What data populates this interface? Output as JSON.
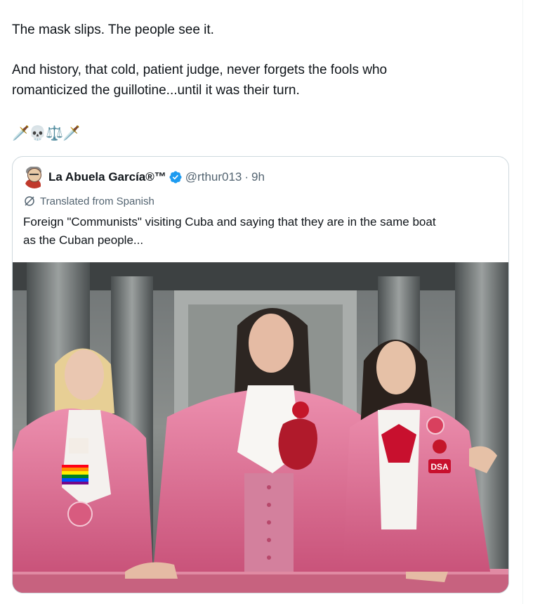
{
  "tweet": {
    "paragraph1": "The mask slips. The people see it.",
    "paragraph2_line1": "And history, that cold, patient judge, never forgets the fools who",
    "paragraph2_line2": "romanticized the guillotine...until it was their turn.",
    "emojis": [
      "🗡️",
      "💀",
      "⚖️",
      "🗡️"
    ]
  },
  "quoted": {
    "display_name": "La Abuela García®™",
    "handle": "@rthur013",
    "separator": "·",
    "time": "9h",
    "translated_label": "Translated from Spanish",
    "text_line1": "Foreign \"Communists\" visiting Cuba and saying that they are in the same boat",
    "text_line2": "as the Cuban people...",
    "photo_badges": {
      "dsa": "DSA"
    }
  },
  "colors": {
    "verified_blue": "#1d9bf0",
    "secondary_text": "#536471",
    "border": "#cfd9de",
    "pink_suit": "#e3789a"
  }
}
